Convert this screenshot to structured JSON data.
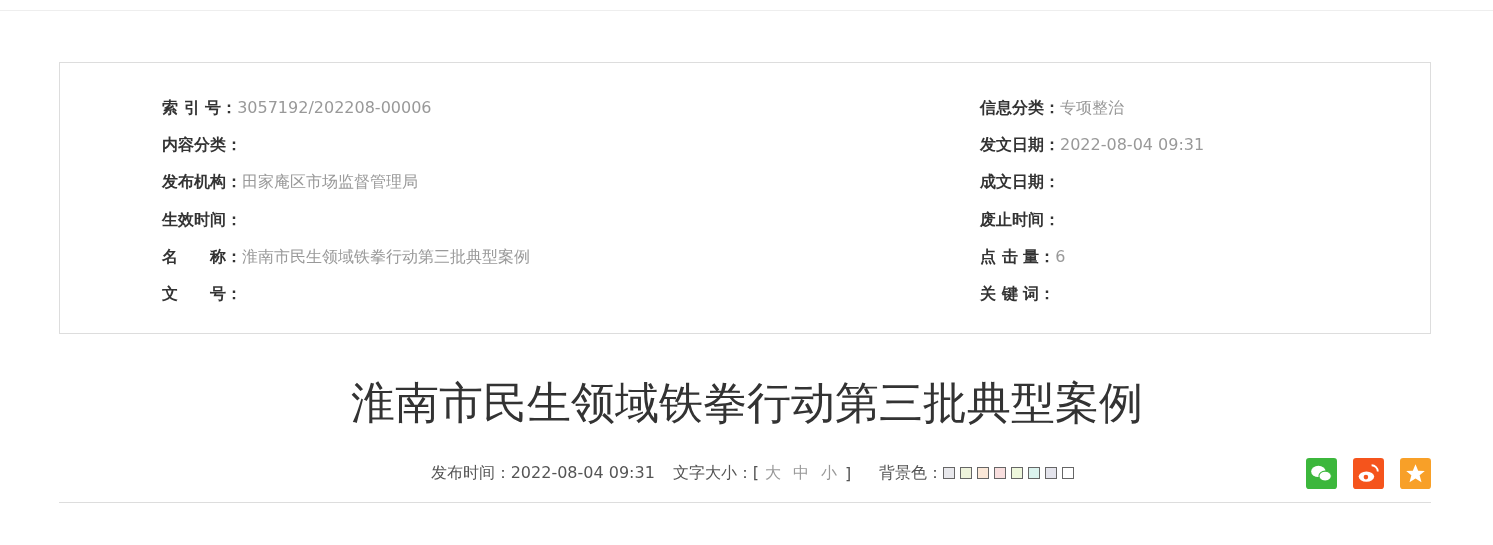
{
  "info_left": [
    {
      "label": "索 引 号",
      "value": "3057192/202208-00006"
    },
    {
      "label": "内容分类"
    },
    {
      "label": "发布机构",
      "value": "田家庵区市场监督管理局"
    },
    {
      "label": "生效时间"
    },
    {
      "label": "名　　称",
      "value": "淮南市民生领域铁拳行动第三批典型案例"
    },
    {
      "label": "文　　号"
    }
  ],
  "info_right": [
    {
      "label": "信息分类",
      "value": "专项整治"
    },
    {
      "label": "发文日期",
      "value": "2022-08-04 09:31"
    },
    {
      "label": "成文日期"
    },
    {
      "label": "废止时间"
    },
    {
      "label": "点 击 量",
      "value": "6"
    },
    {
      "label": "关 键 词"
    }
  ],
  "colon": "：",
  "title": "淮南市民生领域铁拳行动第三批典型案例",
  "meta": {
    "publish": "发布时间：2022-08-04 09:31",
    "font_size_label": "文字大小：[",
    "font_sizes": [
      "大",
      "中",
      "小"
    ],
    "bracket_close": "]",
    "bg_label": "背景色：",
    "swatches": [
      {
        "color": "#e8e8ec"
      },
      {
        "color": "#eef3dc"
      },
      {
        "color": "#fbe8d8"
      },
      {
        "color": "#f8dede"
      },
      {
        "color": "#eef7dc"
      },
      {
        "color": "#dcf3ee"
      },
      {
        "color": "#e4e4ec"
      },
      {
        "color": "#ffffff"
      }
    ]
  },
  "share": [
    {
      "kind": "wechat"
    },
    {
      "kind": "weibo"
    },
    {
      "kind": "qzone"
    }
  ]
}
